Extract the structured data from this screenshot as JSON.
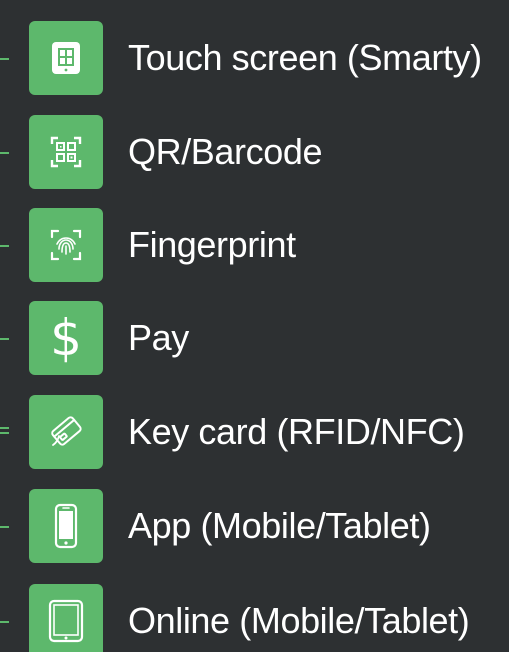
{
  "colors": {
    "background": "#2d3032",
    "accent": "#5db86c",
    "text": "#ffffff"
  },
  "options": [
    {
      "icon": "touch-screen-icon",
      "label": "Touch screen (Smarty)"
    },
    {
      "icon": "qr-barcode-icon",
      "label": "QR/Barcode"
    },
    {
      "icon": "fingerprint-icon",
      "label": "Fingerprint"
    },
    {
      "icon": "dollar-icon",
      "label": "Pay",
      "glyph": "$"
    },
    {
      "icon": "key-card-icon",
      "label": "Key card (RFID/NFC)"
    },
    {
      "icon": "mobile-phone-icon",
      "label": "App (Mobile/Tablet)"
    },
    {
      "icon": "tablet-icon",
      "label": "Online (Mobile/Tablet)"
    }
  ]
}
